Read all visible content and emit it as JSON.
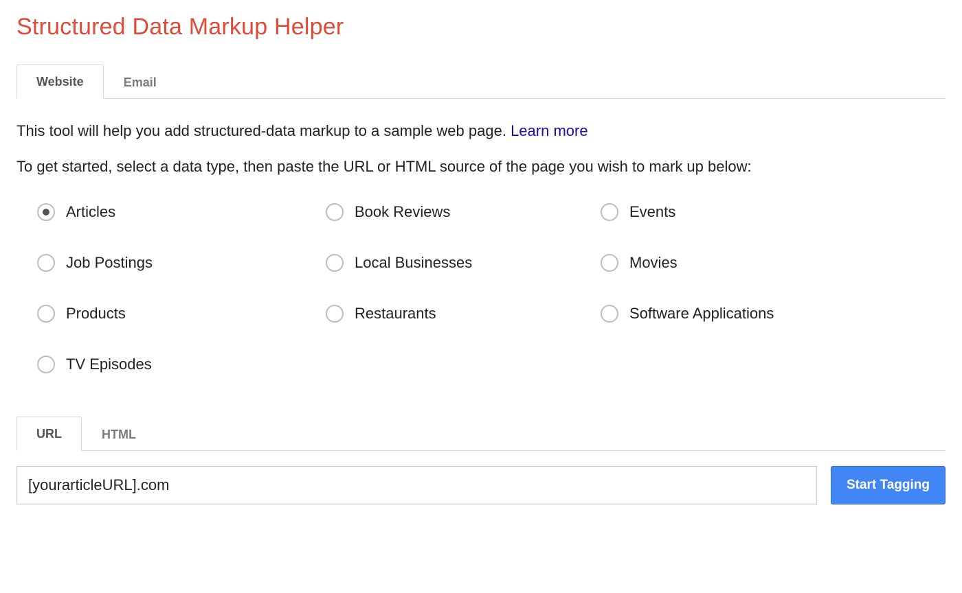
{
  "title": "Structured Data Markup Helper",
  "tabs": {
    "source": [
      {
        "label": "Website",
        "active": true
      },
      {
        "label": "Email",
        "active": false
      }
    ],
    "input": [
      {
        "label": "URL",
        "active": true
      },
      {
        "label": "HTML",
        "active": false
      }
    ]
  },
  "intro": {
    "text": "This tool will help you add structured-data markup to a sample web page. ",
    "link": "Learn more"
  },
  "lead": "To get started, select a data type, then paste the URL or HTML source of the page you wish to mark up below:",
  "datatypes": [
    {
      "label": "Articles",
      "checked": true
    },
    {
      "label": "Book Reviews",
      "checked": false
    },
    {
      "label": "Events",
      "checked": false
    },
    {
      "label": "Job Postings",
      "checked": false
    },
    {
      "label": "Local Businesses",
      "checked": false
    },
    {
      "label": "Movies",
      "checked": false
    },
    {
      "label": "Products",
      "checked": false
    },
    {
      "label": "Restaurants",
      "checked": false
    },
    {
      "label": "Software Applications",
      "checked": false
    },
    {
      "label": "TV Episodes",
      "checked": false
    }
  ],
  "url_input": {
    "value": "[yourarticleURL].com"
  },
  "buttons": {
    "start": "Start Tagging"
  }
}
